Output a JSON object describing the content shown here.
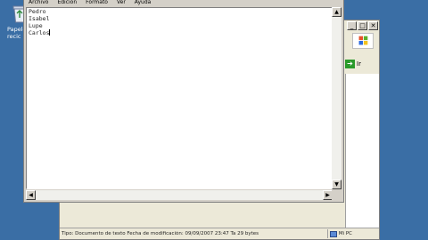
{
  "desktop": {
    "recycle_bin_line1": "Papele",
    "recycle_bin_line2": "recic"
  },
  "notepad": {
    "menu": [
      "Archivo",
      "Edición",
      "Formato",
      "Ver",
      "Ayuda"
    ],
    "lines": [
      "Pedro",
      "Isabel",
      "Lupe",
      "Carlos"
    ]
  },
  "explorer": {
    "minimize": "_",
    "maximize": "□",
    "close": "✕",
    "go_label": "Ir",
    "status_text": "Tipo: Documento de texto Fecha de modificación: 09/09/2007 23:47 Ta 29 bytes",
    "status_size": "29 bytes",
    "status_location": "Mi PC"
  },
  "colors": {
    "desktop": "#3a6ea5",
    "window_face": "#d4d0c8",
    "go_arrow": "#2a9a2a"
  },
  "icons": [
    "recycle-bin-icon",
    "windows-logo-icon",
    "go-arrow-icon",
    "computer-icon",
    "scroll-up-icon",
    "scroll-down-icon",
    "scroll-left-icon",
    "scroll-right-icon"
  ]
}
